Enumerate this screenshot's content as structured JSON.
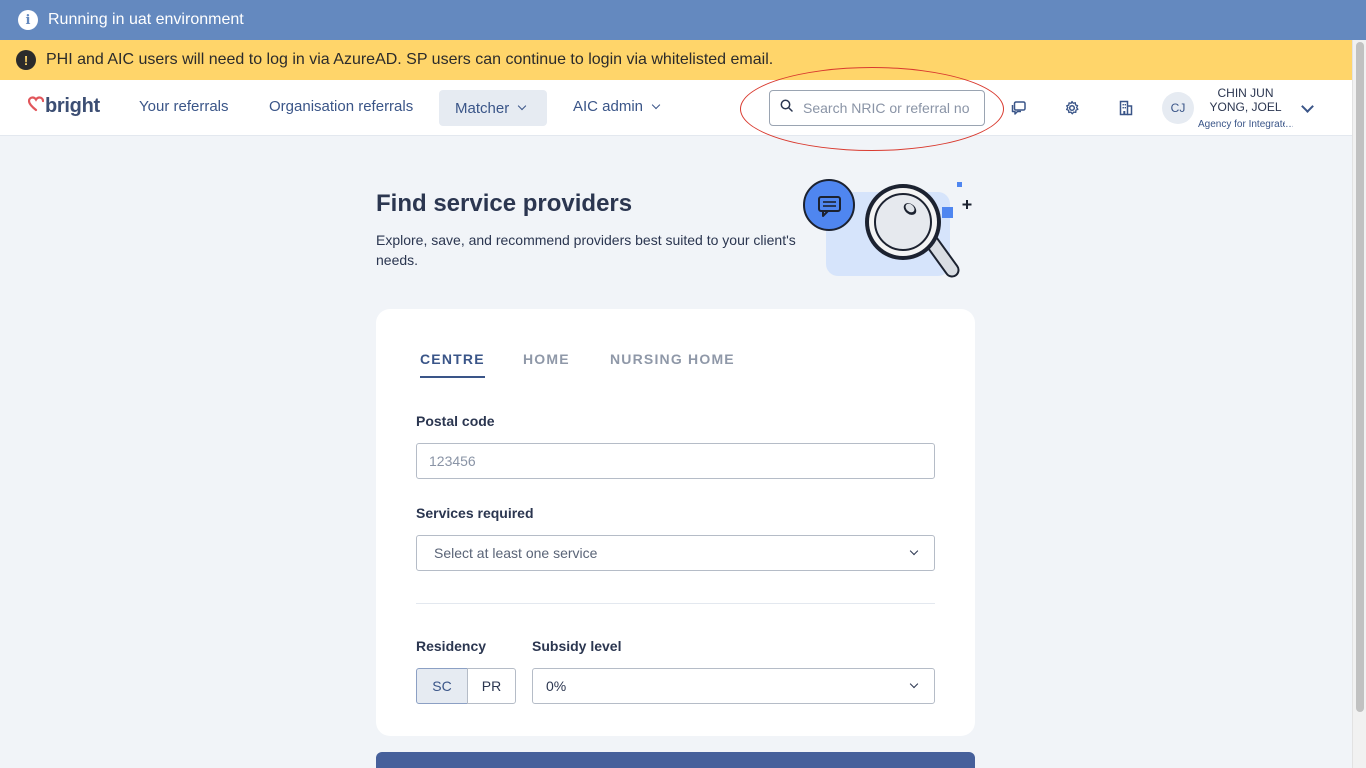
{
  "banners": {
    "info_text": "Running in uat environment",
    "warning_text": "PHI and AIC users will need to log in via AzureAD. SP users can continue to login via whitelisted email."
  },
  "nav": {
    "logo": "bright",
    "links": [
      "Your referrals",
      "Organisation referrals",
      "Matcher",
      "AIC admin"
    ],
    "search_placeholder": "Search NRIC or referral no.",
    "search_value": "",
    "user": {
      "initials": "CJ",
      "name": "CHIN JUN YONG, JOEL",
      "org": "Agency for Integrated Care"
    }
  },
  "page": {
    "title": "Find service providers",
    "description": "Explore, save, and recommend providers best suited to your client's needs."
  },
  "form": {
    "tabs": [
      "CENTRE",
      "HOME",
      "NURSING HOME"
    ],
    "active_tab": "CENTRE",
    "postal_code": {
      "label": "Postal code",
      "placeholder": "123456",
      "value": ""
    },
    "services": {
      "label": "Services required",
      "placeholder": "Select at least one service"
    },
    "residency": {
      "label": "Residency",
      "options": [
        "SC",
        "PR"
      ],
      "selected": "SC"
    },
    "subsidy": {
      "label": "Subsidy level",
      "value": "0%"
    }
  },
  "colors": {
    "info_banner": "#6489bf",
    "warning_banner": "#ffd56a",
    "primary": "#3a5588",
    "brand_logo": "#e1565b",
    "annotation_circle": "#d93a2f"
  }
}
